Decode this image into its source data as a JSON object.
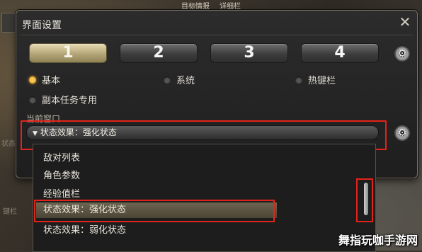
{
  "background": {
    "top_fragment": "目标情报",
    "top_fragment2": "详细栏",
    "left_fragment": "状态",
    "left_fragment2": "键栏"
  },
  "window": {
    "title": "界面设置",
    "close_icon": "close-x-icon"
  },
  "tabs": [
    {
      "label": "1",
      "active": true
    },
    {
      "label": "2",
      "active": false
    },
    {
      "label": "3",
      "active": false
    },
    {
      "label": "4",
      "active": false
    }
  ],
  "radios": [
    {
      "label": "基本",
      "selected": true
    },
    {
      "label": "系统",
      "selected": false
    },
    {
      "label": "热键栏",
      "selected": false
    },
    {
      "label": "副本任务专用",
      "selected": false
    }
  ],
  "current_window": {
    "label": "当前窗口",
    "selected_value": "状态效果：强化状态"
  },
  "dropdown_options": [
    {
      "label": "敌对列表"
    },
    {
      "label": "角色参数"
    },
    {
      "label": "经验值栏"
    },
    {
      "label": "状态效果：强化状态",
      "highlighted": true
    },
    {
      "label": "状态效果：弱化状态"
    }
  ],
  "colors": {
    "highlight_box": "#e2231a",
    "active_tab": "#b3a577",
    "radio_on": "#e39a1c"
  },
  "watermark": "舞指玩咖手游网"
}
